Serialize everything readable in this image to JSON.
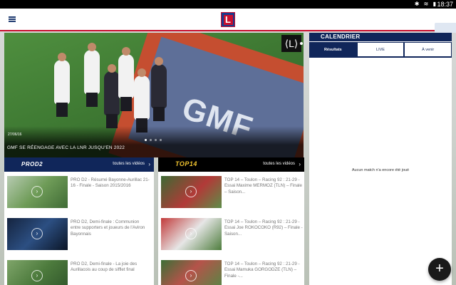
{
  "status_bar": {
    "time": "18:37",
    "icons": [
      "bluetooth-icon",
      "wifi-icon",
      "battery-icon"
    ]
  },
  "colors": {
    "navy": "#10265a",
    "accent_red": "#c8102e",
    "black": "#000000"
  },
  "header": {
    "logo_text": "L"
  },
  "hero": {
    "date": "27/06/16",
    "title": "GMF SE RÉENGAGE AVEC LA LNR JUSQU'EN 2022",
    "banner_text": "GMF",
    "slides": 4,
    "active_slide": 0
  },
  "columns": [
    {
      "brand": "PROD2",
      "all_videos_label": "toutes les vidéos",
      "items": [
        {
          "text": "PRO D2 - Résumé Bayonne-Aurillac 21-16 - Finale - Saison 2015/2016"
        },
        {
          "text": "PRO D2, Demi-finale : Communion entre supporters et joueurs de l'Aviron Bayonnais"
        },
        {
          "text": "PRO D2, Demi-finale - La joie des Aurillacois au coup de sifflet final"
        }
      ]
    },
    {
      "brand": "TOP14",
      "all_videos_label": "toutes les vidéos",
      "items": [
        {
          "text": "TOP 14 – Toulon – Racing 92 : 21-29 - Essai Maxime MERMOZ (TLN) – Finale – Saison..."
        },
        {
          "text": "TOP 14 – Toulon – Racing 92 : 21-29 - Essai Joe ROKOCOKO (R92) – Finale - Saison..."
        },
        {
          "text": "TOP 14 – Toulon – Racing 92 : 21-29 - Essai Mamuka GORGODZE (TLN) – Finale -..."
        }
      ]
    }
  ],
  "calendar": {
    "title": "CALENDRIER",
    "tabs": [
      "Résultats",
      "LIVE",
      "À venir"
    ],
    "active_tab": 0,
    "empty_message": "Aucun match n'a encore été joué"
  },
  "fab": {
    "icon": "plus-icon",
    "label": "+"
  }
}
